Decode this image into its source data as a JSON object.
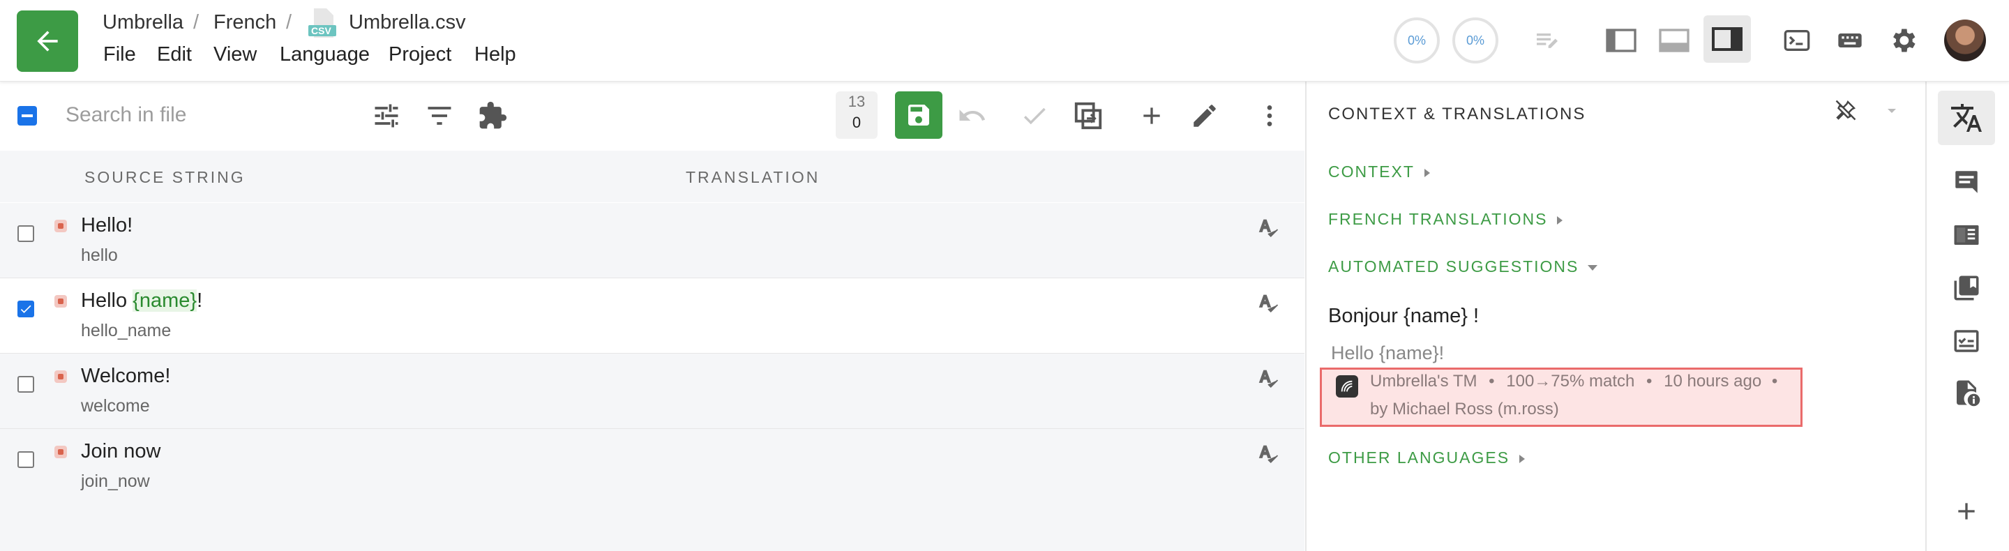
{
  "breadcrumb": {
    "project": "Umbrella",
    "language": "French",
    "file_badge": "CSV",
    "file": "Umbrella.csv"
  },
  "menu": [
    "File",
    "Edit",
    "View",
    "Language",
    "Project",
    "Help"
  ],
  "progress": {
    "approved": "0%",
    "translated": "0%"
  },
  "colors": {
    "brand_green": "#3d9b45",
    "accent_blue": "#1a73e8",
    "highlight_red": "#ea6b6b"
  },
  "search": {
    "placeholder": "Search in file"
  },
  "counter": {
    "top": "13",
    "bottom": "0"
  },
  "columns": {
    "source": "SOURCE STRING",
    "translation": "TRANSLATION"
  },
  "rows": [
    {
      "source_before": "Hello!",
      "source_var": "",
      "source_after": "",
      "key": "hello",
      "checked": false
    },
    {
      "source_before": "Hello ",
      "source_var": "{name}",
      "source_after": "!",
      "key": "hello_name",
      "checked": true
    },
    {
      "source_before": "Welcome!",
      "source_var": "",
      "source_after": "",
      "key": "welcome",
      "checked": false
    },
    {
      "source_before": "Join now",
      "source_var": "",
      "source_after": "",
      "key": "join_now",
      "checked": false
    }
  ],
  "panel": {
    "title": "CONTEXT & TRANSLATIONS",
    "sections": {
      "context": "CONTEXT",
      "french": "FRENCH TRANSLATIONS",
      "automated": "AUTOMATED SUGGESTIONS",
      "other": "OTHER LANGUAGES"
    },
    "suggestion": {
      "text": "Bonjour {name} !",
      "source": "Hello {name}!",
      "tm_name": "Umbrella's TM",
      "match": "100→75% match",
      "time": "10 hours ago",
      "author": "by Michael Ross (m.ross)"
    }
  },
  "icons": [
    "arrow-left-icon",
    "csv-file-icon",
    "edit-list-icon",
    "left-panel-icon",
    "bottom-panel-icon",
    "right-panel-icon",
    "terminal-icon",
    "keyboard-icon",
    "gear-icon",
    "sliders-icon",
    "filter-icon",
    "puzzle-icon",
    "save-icon",
    "undo-icon",
    "check-icon",
    "copy-icon",
    "plus-icon",
    "pencil-icon",
    "more-vert-icon",
    "spellcheck-icon",
    "pin-off-icon",
    "translate-icon",
    "comment-icon",
    "book-icon",
    "library-icon",
    "checklist-icon",
    "file-info-icon"
  ]
}
